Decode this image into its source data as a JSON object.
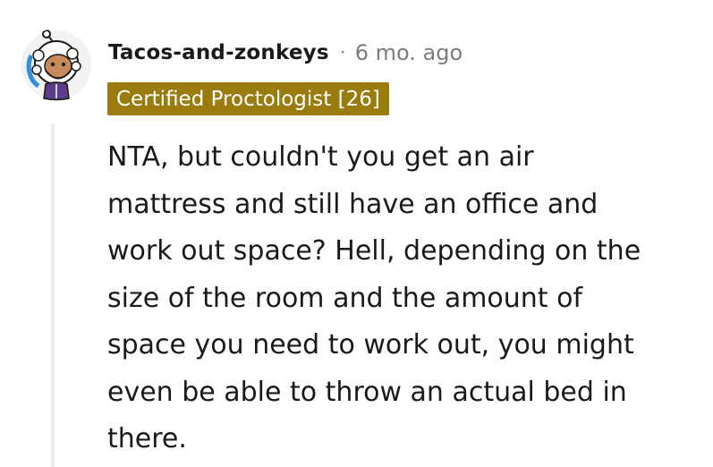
{
  "comment": {
    "author": "Tacos-and-zonkeys",
    "separator": "·",
    "time_ago": "6 mo. ago",
    "flair": "Certified Proctologist [26]",
    "body_lines": [
      "NTA, but couldn't you get an air",
      "mattress and still have an office and",
      "work out space? Hell, depending on the",
      "size of the room and the amount of",
      "space you need to work out, you might",
      "even be able to throw an actual bed in",
      "there."
    ],
    "avatar_icon": "snoo-avatar-icon"
  },
  "colors": {
    "flair_background": "#9a7b0e",
    "flair_text": "#ffffff",
    "timestamp": "#7c7c7c",
    "thread_line": "#ededed",
    "body_text": "#1a1a1b"
  }
}
